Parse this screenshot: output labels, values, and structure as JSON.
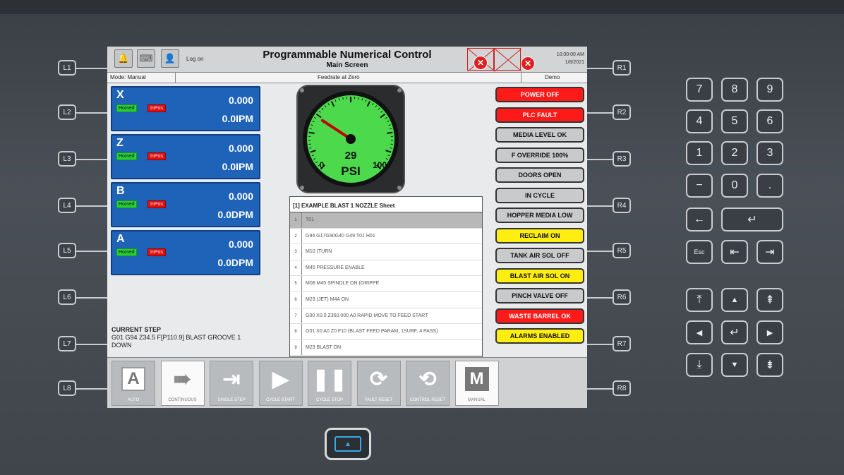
{
  "side_left": [
    "L1",
    "L2",
    "L3",
    "L4",
    "L5",
    "L6",
    "L7",
    "L8"
  ],
  "side_right": [
    "R1",
    "R2",
    "R3",
    "R4",
    "R5",
    "R6",
    "R7",
    "R8"
  ],
  "header": {
    "logon": "Log on",
    "title": "Programmable Numerical Control",
    "subtitle": "Main Screen",
    "time": "10:00:00 AM",
    "date": "1/8/2021"
  },
  "status_bar": {
    "mode": "Mode: Manual",
    "feedrate": "Feedrate at Zero",
    "demo": "Demo"
  },
  "axes": [
    {
      "name": "X",
      "position": "0.000",
      "feed": "0.0IPM",
      "homed": "Homed",
      "inpos": "InPos"
    },
    {
      "name": "Z",
      "position": "0.000",
      "feed": "0.0IPM",
      "homed": "Homed",
      "inpos": "InPos"
    },
    {
      "name": "B",
      "position": "0.000",
      "feed": "0.0DPM",
      "homed": "Homed",
      "inpos": "InPos"
    },
    {
      "name": "A",
      "position": "0.000",
      "feed": "0.0DPM",
      "homed": "Homed",
      "inpos": "InPos"
    }
  ],
  "gauge": {
    "value": 29,
    "value_text": "29",
    "min_text": "0",
    "max_text": "100",
    "min": 0,
    "max": 100,
    "unit": "PSI",
    "face_color": "#4cd94c"
  },
  "program": {
    "header": "[1] EXAMPLE BLAST 1 NOZZLE Sheet",
    "rows": [
      {
        "n": "1",
        "text": "T01"
      },
      {
        "n": "2",
        "text": "G94 G17G90G40 G49 T01 H01"
      },
      {
        "n": "3",
        "text": "M10 (TURN"
      },
      {
        "n": "4",
        "text": "M45 PRESSURE ENABLE"
      },
      {
        "n": "5",
        "text": "M08 M45 SPINDLE ON (GRIPPE"
      },
      {
        "n": "6",
        "text": "M23 (JET) M4A ON"
      },
      {
        "n": "7",
        "text": "G00 X0.0 Z350.000 A0 RAPID MOVE TO FEED START"
      },
      {
        "n": "8",
        "text": "G01 X0 A0 Z0 F10 (BLAST FEED PARAM, 1SURF, 4 PASS)"
      },
      {
        "n": "9",
        "text": "M23 BLAST ON"
      }
    ]
  },
  "current_step": {
    "label": "CURRENT STEP",
    "line1": "G01 G94 Z34.5 F[P110.9] BLAST GROOVE 1",
    "line2": "DOWN"
  },
  "status_buttons": [
    {
      "label": "POWER OFF",
      "bg": "#ff1a1a",
      "fg": "#ffffff"
    },
    {
      "label": "PLC FAULT",
      "bg": "#ff1a1a",
      "fg": "#ffffff"
    },
    {
      "label": "MEDIA LEVEL OK",
      "bg": "#c8cacc",
      "fg": "#111111"
    },
    {
      "label": "F OVERRIDE 100%",
      "bg": "#c8cacc",
      "fg": "#111111"
    },
    {
      "label": "DOORS OPEN",
      "bg": "#c8cacc",
      "fg": "#111111"
    },
    {
      "label": "IN CYCLE",
      "bg": "#c8cacc",
      "fg": "#111111"
    },
    {
      "label": "HOPPER MEDIA LOW",
      "bg": "#c8cacc",
      "fg": "#111111"
    },
    {
      "label": "RECLAIM ON",
      "bg": "#ffee10",
      "fg": "#111111"
    },
    {
      "label": "TANK AIR SOL OFF",
      "bg": "#c8cacc",
      "fg": "#111111"
    },
    {
      "label": "BLAST AIR SOL ON",
      "bg": "#ffee10",
      "fg": "#111111"
    },
    {
      "label": "PINCH VALVE OFF",
      "bg": "#c8cacc",
      "fg": "#111111"
    },
    {
      "label": "WASTE BARREL OK",
      "bg": "#ff1a1a",
      "fg": "#ffffff"
    },
    {
      "label": "ALARMS ENABLED",
      "bg": "#ffee10",
      "fg": "#111111"
    }
  ],
  "bottom_buttons": [
    {
      "label": "AUTO",
      "icon": "A",
      "icon_name": "auto-icon"
    },
    {
      "label": "CONTINUOUS",
      "icon": "➠",
      "icon_name": "continuous-icon"
    },
    {
      "label": "SINGLE STEP",
      "icon": "⇥",
      "icon_name": "single-step-icon"
    },
    {
      "label": "CYCLE START",
      "icon": "▶",
      "icon_name": "play-icon"
    },
    {
      "label": "CYCLE STOP",
      "icon": "❚❚",
      "icon_name": "pause-icon"
    },
    {
      "label": "FAULT RESET",
      "icon": "⟳",
      "icon_name": "reset-icon"
    },
    {
      "label": "CONTROL RESET",
      "icon": "⟲",
      "icon_name": "control-reset-icon"
    },
    {
      "label": "MANUAL",
      "icon": "M",
      "icon_name": "manual-icon"
    }
  ],
  "keypad": {
    "digits": [
      "7",
      "8",
      "9",
      "4",
      "5",
      "6",
      "1",
      "2",
      "3",
      "−",
      "0",
      "."
    ],
    "backspace": "←",
    "enter": "↵",
    "esc": "Esc",
    "prev": "⇤",
    "next": "⇥",
    "top": "⤒",
    "up": "▲",
    "page_up": "⇞",
    "left": "◀",
    "nav_enter": "↵",
    "right": "▶",
    "bottom": "⤓",
    "down": "▼",
    "page_down": "⇟"
  }
}
